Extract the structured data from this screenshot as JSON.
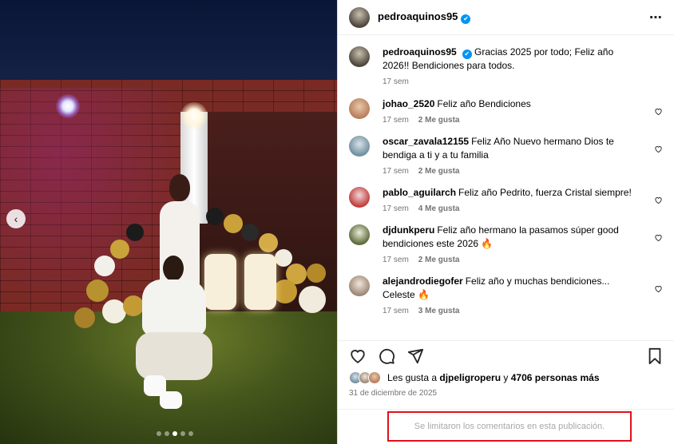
{
  "post": {
    "carousel": {
      "total": 5,
      "active": 3
    }
  },
  "header": {
    "username": "pedroaquinos95",
    "verified_mark": "✔",
    "more_icon": "⋯"
  },
  "caption": {
    "username": "pedroaquinos95",
    "text": "Gracias 2025 por todo; Feliz año 2026!! Bendiciones para todos.",
    "time": "17 sem"
  },
  "comments": [
    {
      "username": "johao_2520",
      "text": "Feliz año Bendiciones",
      "time": "17 sem",
      "likes": "2 Me gusta"
    },
    {
      "username": "oscar_zavala12155",
      "text": "Feliz Año Nuevo hermano Dios te bendiga a ti y a tu familia",
      "time": "17 sem",
      "likes": "2 Me gusta"
    },
    {
      "username": "pablo_aguilarch",
      "text": "Feliz año Pedrito, fuerza Cristal siempre!",
      "time": "17 sem",
      "likes": "4 Me gusta"
    },
    {
      "username": "djdunkperu",
      "text": "Feliz año hermano la pasamos súper good bendiciones este 2026 🔥",
      "time": "17 sem",
      "likes": "2 Me gusta"
    },
    {
      "username": "alejandrodiegofer",
      "text": "Feliz año y muchas bendiciones... Celeste 🔥",
      "time": "17 sem",
      "likes": "3 Me gusta"
    }
  ],
  "likes": {
    "prefix": "Les gusta a ",
    "user": "djpeligroperu",
    "middle": " y ",
    "count": "4706 personas más"
  },
  "date": "31 de diciembre de 2025",
  "limited_notice": "Se limitaron los comentarios en esta publicación.",
  "icons": {
    "heart_small": "♡",
    "prev": "‹"
  }
}
